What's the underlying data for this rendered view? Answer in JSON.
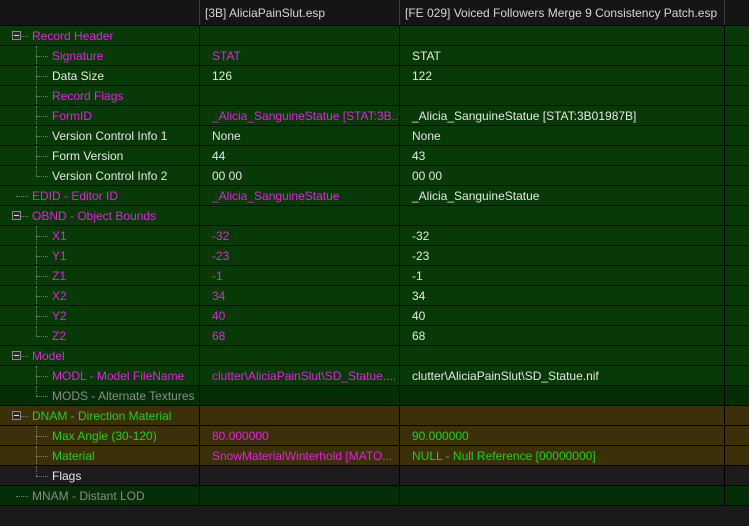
{
  "columns": [
    "",
    "[3B] AliciaPainSlut.esp",
    "[FE 029] Voiced Followers Merge 9 Consistency Patch.esp"
  ],
  "colors": {
    "magenta": "#e81fe4",
    "white": "#e6e6e6",
    "green": "#20d020",
    "gray": "#8a8a8a",
    "bg_green": "#083a08",
    "bg_darkgreen": "#062e06",
    "bg_olive": "#3b300a",
    "bg_dark": "#1c1c1c"
  },
  "rows": [
    {
      "label": "Record Header",
      "level": 0,
      "expandable": true,
      "v1": "",
      "v2": "",
      "lc": "magenta",
      "c1": "magenta",
      "c2": "white",
      "bg": "bg_green"
    },
    {
      "label": "Signature",
      "level": 1,
      "v1": "STAT",
      "v2": "STAT",
      "lc": "magenta",
      "c1": "magenta",
      "c2": "white",
      "bg": "bg_green"
    },
    {
      "label": "Data Size",
      "level": 1,
      "v1": "126",
      "v2": "122",
      "lc": "white",
      "c1": "white",
      "c2": "white",
      "bg": "bg_green"
    },
    {
      "label": "Record Flags",
      "level": 1,
      "v1": "",
      "v2": "",
      "lc": "magenta",
      "c1": "magenta",
      "c2": "white",
      "bg": "bg_green"
    },
    {
      "label": "FormID",
      "level": 1,
      "v1": "_Alicia_SanguineStatue [STAT:3B...",
      "v2": "_Alicia_SanguineStatue [STAT:3B01987B]",
      "lc": "magenta",
      "c1": "magenta",
      "c2": "white",
      "bg": "bg_green"
    },
    {
      "label": "Version Control Info 1",
      "level": 1,
      "v1": "None",
      "v2": "None",
      "lc": "white",
      "c1": "white",
      "c2": "white",
      "bg": "bg_green"
    },
    {
      "label": "Form Version",
      "level": 1,
      "v1": "44",
      "v2": "43",
      "lc": "white",
      "c1": "white",
      "c2": "white",
      "bg": "bg_green"
    },
    {
      "label": "Version Control Info 2",
      "level": 1,
      "last": true,
      "v1": "00 00",
      "v2": "00 00",
      "lc": "white",
      "c1": "white",
      "c2": "white",
      "bg": "bg_green"
    },
    {
      "label": "EDID - Editor ID",
      "level": 0,
      "v1": "_Alicia_SanguineStatue",
      "v2": "_Alicia_SanguineStatue",
      "lc": "magenta",
      "c1": "magenta",
      "c2": "white",
      "bg": "bg_green"
    },
    {
      "label": "OBND - Object Bounds",
      "level": 0,
      "expandable": true,
      "v1": "",
      "v2": "",
      "lc": "magenta",
      "c1": "magenta",
      "c2": "white",
      "bg": "bg_green"
    },
    {
      "label": "X1",
      "level": 1,
      "v1": "-32",
      "v2": "-32",
      "lc": "magenta",
      "c1": "magenta",
      "c2": "white",
      "bg": "bg_green"
    },
    {
      "label": "Y1",
      "level": 1,
      "v1": "-23",
      "v2": "-23",
      "lc": "magenta",
      "c1": "magenta",
      "c2": "white",
      "bg": "bg_green"
    },
    {
      "label": "Z1",
      "level": 1,
      "v1": "-1",
      "v2": "-1",
      "lc": "magenta",
      "c1": "magenta",
      "c2": "white",
      "bg": "bg_green"
    },
    {
      "label": "X2",
      "level": 1,
      "v1": "34",
      "v2": "34",
      "lc": "magenta",
      "c1": "magenta",
      "c2": "white",
      "bg": "bg_green"
    },
    {
      "label": "Y2",
      "level": 1,
      "v1": "40",
      "v2": "40",
      "lc": "magenta",
      "c1": "magenta",
      "c2": "white",
      "bg": "bg_green"
    },
    {
      "label": "Z2",
      "level": 1,
      "last": true,
      "v1": "68",
      "v2": "68",
      "lc": "magenta",
      "c1": "magenta",
      "c2": "white",
      "bg": "bg_green"
    },
    {
      "label": "Model",
      "level": 0,
      "expandable": true,
      "v1": "",
      "v2": "",
      "lc": "magenta",
      "c1": "magenta",
      "c2": "white",
      "bg": "bg_green"
    },
    {
      "label": "MODL - Model FileName",
      "level": 1,
      "v1": "clutter\\AliciaPainSlut\\SD_Statue....",
      "v2": "clutter\\AliciaPainSlut\\SD_Statue.nif",
      "lc": "magenta",
      "c1": "magenta",
      "c2": "white",
      "bg": "bg_green"
    },
    {
      "label": "MODS - Alternate Textures",
      "level": 1,
      "last": true,
      "v1": "",
      "v2": "",
      "lc": "gray",
      "c1": "gray",
      "c2": "gray",
      "bg": "bg_darkgreen"
    },
    {
      "label": "DNAM - Direction Material",
      "level": 0,
      "expandable": true,
      "v1": "",
      "v2": "",
      "lc": "green",
      "c1": "green",
      "c2": "green",
      "bg": "bg_olive"
    },
    {
      "label": "Max Angle (30-120)",
      "level": 1,
      "v1": "80.000000",
      "v2": "90.000000",
      "lc": "green",
      "c1": "magenta",
      "c2": "green",
      "bg": "bg_olive"
    },
    {
      "label": "Material",
      "level": 1,
      "v1": "SnowMaterialWinterhold [MATO...",
      "v2": "NULL - Null Reference [00000000]",
      "lc": "green",
      "c1": "magenta",
      "c2": "green",
      "bg": "bg_olive"
    },
    {
      "label": "Flags",
      "level": 1,
      "last": true,
      "v1": "",
      "v2": "",
      "lc": "white",
      "c1": "white",
      "c2": "white",
      "bg": "bg_dark"
    },
    {
      "label": "MNAM - Distant LOD",
      "level": 0,
      "lastTop": true,
      "v1": "",
      "v2": "",
      "lc": "gray",
      "c1": "gray",
      "c2": "gray",
      "bg": "bg_darkgreen"
    }
  ]
}
